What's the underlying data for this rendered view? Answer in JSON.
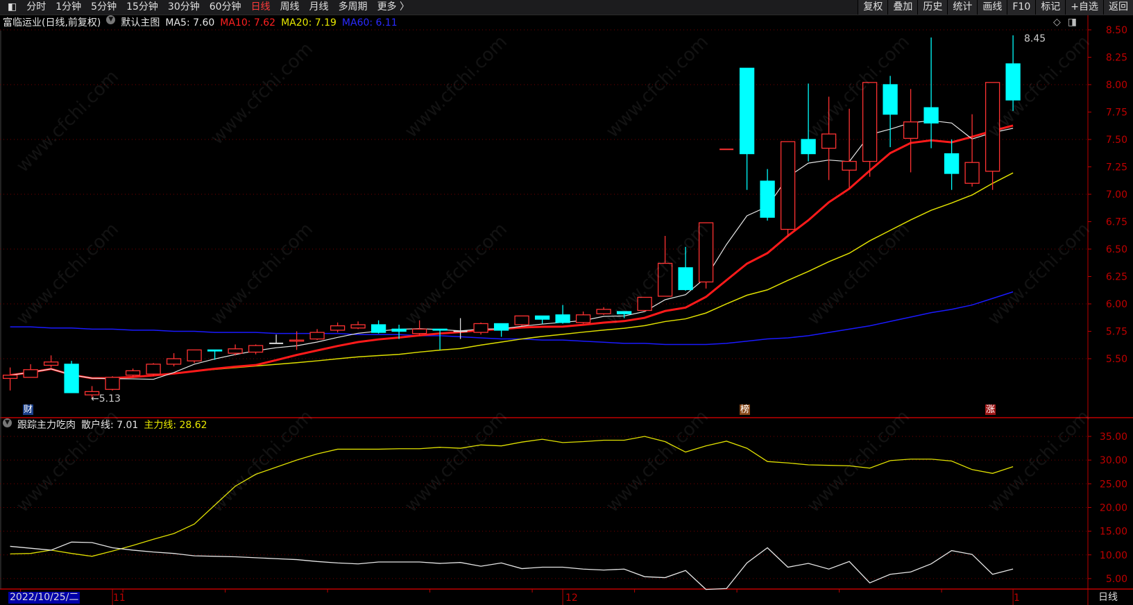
{
  "toolbar": {
    "left_items": [
      "分时",
      "1分钟",
      "5分钟",
      "15分钟",
      "30分钟",
      "60分钟",
      "日线",
      "周线",
      "月线",
      "多周期",
      "更多 〉"
    ],
    "active_item": "日线",
    "right_buttons": [
      "复权",
      "叠加",
      "历史",
      "统计",
      "画线",
      "F10",
      "标记",
      "+自选",
      "返回"
    ]
  },
  "header": {
    "title": "富临运业(日线,前复权)",
    "template": "默认主图",
    "ma5": "MA5: 7.60",
    "ma10": "MA10: 7.62",
    "ma20": "MA20: 7.19",
    "ma60": "MA60: 6.11"
  },
  "sub_header": {
    "title": "跟踪主力吃肉",
    "retail": "散户线: 7.01",
    "main": "主力线: 28.62"
  },
  "colors": {
    "up": "#ff3232",
    "down": "#00ffff",
    "ma5": "#e6e6e6",
    "ma10": "#ff1a1a",
    "ma20": "#e0e000",
    "ma60": "#1a1aff",
    "axis": "#c00000"
  },
  "footer": {
    "date": "2022/10/25/二",
    "period": "日线",
    "month_labels": [
      "11",
      "12",
      "1"
    ]
  },
  "markers": {
    "cai": "财",
    "bang": "榜",
    "zhang": "涨",
    "low_label": "←5.13",
    "high_label": "8.45"
  },
  "watermark": "www.cfchi.com",
  "chart_data": [
    {
      "type": "candlestick",
      "title": "富临运业 日线",
      "y_ticks": [
        "8.50",
        "8.25",
        "8.00",
        "7.75",
        "7.50",
        "7.25",
        "7.00",
        "6.75",
        "6.50",
        "6.25",
        "6.00",
        "5.75",
        "5.50"
      ],
      "ylim": [
        5.25,
        8.5
      ],
      "month_starts": {
        "11": 5,
        "12": 27,
        "1": 49
      },
      "ohlc": [
        [
          5.32,
          5.42,
          5.21,
          5.35
        ],
        [
          5.33,
          5.45,
          5.33,
          5.4
        ],
        [
          5.44,
          5.53,
          5.42,
          5.47
        ],
        [
          5.45,
          5.48,
          5.19,
          5.19
        ],
        [
          5.17,
          5.25,
          5.13,
          5.2
        ],
        [
          5.22,
          5.34,
          5.21,
          5.33
        ],
        [
          5.35,
          5.41,
          5.33,
          5.39
        ],
        [
          5.36,
          5.46,
          5.34,
          5.45
        ],
        [
          5.45,
          5.55,
          5.43,
          5.5
        ],
        [
          5.48,
          5.58,
          5.46,
          5.58
        ],
        [
          5.58,
          5.58,
          5.49,
          5.57
        ],
        [
          5.55,
          5.63,
          5.53,
          5.59
        ],
        [
          5.56,
          5.63,
          5.54,
          5.62
        ],
        [
          5.64,
          5.72,
          5.64,
          5.64
        ],
        [
          5.66,
          5.75,
          5.58,
          5.67
        ],
        [
          5.68,
          5.77,
          5.67,
          5.74
        ],
        [
          5.76,
          5.83,
          5.74,
          5.8
        ],
        [
          5.78,
          5.84,
          5.77,
          5.81
        ],
        [
          5.81,
          5.85,
          5.73,
          5.74
        ],
        [
          5.77,
          5.81,
          5.68,
          5.75
        ],
        [
          5.73,
          5.85,
          5.71,
          5.77
        ],
        [
          5.77,
          5.77,
          5.58,
          5.76
        ],
        [
          5.75,
          5.87,
          5.68,
          5.75
        ],
        [
          5.74,
          5.83,
          5.72,
          5.82
        ],
        [
          5.82,
          5.82,
          5.7,
          5.76
        ],
        [
          5.81,
          5.89,
          5.8,
          5.89
        ],
        [
          5.89,
          5.89,
          5.82,
          5.86
        ],
        [
          5.9,
          5.99,
          5.82,
          5.83
        ],
        [
          5.83,
          5.93,
          5.82,
          5.9
        ],
        [
          5.91,
          5.97,
          5.9,
          5.95
        ],
        [
          5.93,
          5.93,
          5.87,
          5.91
        ],
        [
          5.94,
          6.06,
          5.93,
          6.06
        ],
        [
          6.07,
          6.62,
          6.07,
          6.37
        ],
        [
          6.33,
          6.52,
          6.12,
          6.13
        ],
        [
          6.2,
          6.74,
          6.14,
          6.74
        ],
        [
          7.41,
          7.41,
          7.41,
          7.41
        ],
        [
          8.15,
          8.15,
          7.04,
          7.37
        ],
        [
          7.12,
          7.23,
          6.76,
          6.79
        ],
        [
          6.68,
          7.48,
          6.61,
          7.48
        ],
        [
          7.5,
          8.01,
          7.3,
          7.37
        ],
        [
          7.42,
          7.89,
          7.13,
          7.55
        ],
        [
          7.22,
          7.78,
          7.05,
          7.3
        ],
        [
          7.3,
          8.02,
          7.16,
          8.02
        ],
        [
          8.0,
          8.08,
          7.43,
          7.73
        ],
        [
          7.51,
          7.96,
          7.2,
          7.66
        ],
        [
          7.79,
          8.43,
          7.42,
          7.65
        ],
        [
          7.37,
          7.5,
          7.04,
          7.19
        ],
        [
          7.1,
          7.73,
          7.07,
          7.29
        ],
        [
          7.21,
          8.02,
          7.04,
          8.02
        ],
        [
          8.19,
          8.45,
          7.76,
          7.86
        ]
      ],
      "ma60": [
        5.79,
        5.79,
        5.78,
        5.78,
        5.77,
        5.77,
        5.76,
        5.76,
        5.75,
        5.75,
        5.74,
        5.74,
        5.74,
        5.73,
        5.73,
        5.73,
        5.73,
        5.72,
        5.72,
        5.72,
        5.71,
        5.71,
        5.7,
        5.69,
        5.68,
        5.68,
        5.67,
        5.67,
        5.66,
        5.65,
        5.64,
        5.64,
        5.63,
        5.63,
        5.63,
        5.64,
        5.66,
        5.68,
        5.69,
        5.71,
        5.74,
        5.77,
        5.8,
        5.84,
        5.88,
        5.92,
        5.95,
        5.99,
        6.05,
        6.11
      ],
      "series_names": [
        "MA5",
        "MA10",
        "MA20",
        "MA60"
      ]
    },
    {
      "type": "line",
      "title": "跟踪主力吃肉",
      "y_ticks": [
        "35.00",
        "30.00",
        "25.00",
        "20.00",
        "15.00",
        "10.00",
        "5.00"
      ],
      "ylim": [
        1.5,
        38.5
      ],
      "series": [
        {
          "name": "散户线",
          "values": [
            11.8,
            11.4,
            11.0,
            12.7,
            12.6,
            11.5,
            11.0,
            10.6,
            10.3,
            9.8,
            9.7,
            9.6,
            9.4,
            9.2,
            9.0,
            8.6,
            8.3,
            8.1,
            8.5,
            8.5,
            8.5,
            8.2,
            8.4,
            7.6,
            8.3,
            7.1,
            7.4,
            7.4,
            7.0,
            6.8,
            7.0,
            5.4,
            5.2,
            6.7,
            2.7,
            2.9,
            8.3,
            11.5,
            7.4,
            8.2,
            7.0,
            8.6,
            4.1,
            5.9,
            6.4,
            8.1,
            10.9,
            10.1,
            5.9,
            7.01
          ]
        },
        {
          "name": "主力线",
          "values": [
            10.2,
            10.3,
            11.0,
            10.3,
            9.7,
            10.8,
            12.0,
            13.3,
            14.5,
            16.5,
            20.5,
            24.5,
            27.0,
            28.5,
            30.0,
            31.3,
            32.3,
            32.3,
            32.3,
            32.4,
            32.4,
            32.7,
            32.5,
            33.2,
            33.0,
            33.8,
            34.4,
            33.7,
            33.9,
            34.2,
            34.2,
            35.0,
            33.9,
            31.7,
            33.0,
            34.0,
            32.5,
            29.7,
            29.4,
            29.0,
            28.9,
            28.8,
            28.3,
            29.9,
            30.2,
            30.2,
            29.8,
            28.0,
            27.2,
            28.62
          ]
        }
      ]
    }
  ]
}
